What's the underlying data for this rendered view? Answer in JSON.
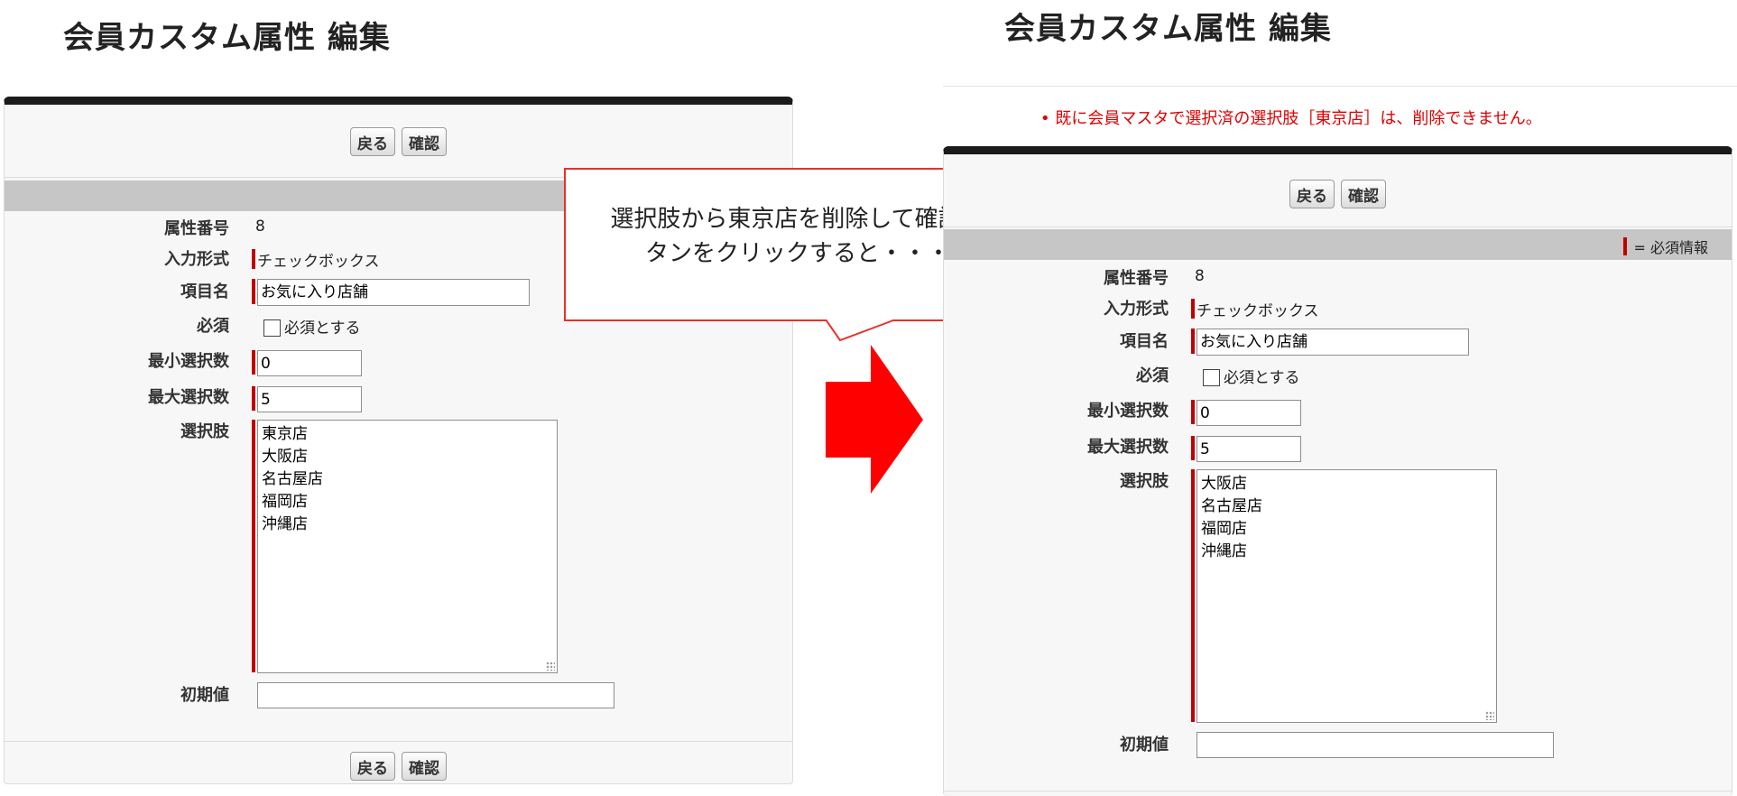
{
  "left": {
    "title": "会員カスタム属性 編集",
    "back_label": "戻る",
    "confirm_label": "確認",
    "fields": {
      "attr_no_label": "属性番号",
      "attr_no_value": "8",
      "input_type_label": "入力形式",
      "input_type_value": "チェックボックス",
      "item_name_label": "項目名",
      "item_name_value": "お気に入り店舗",
      "required_label": "必須",
      "required_checkbox_label": "必須とする",
      "min_label": "最小選択数",
      "min_value": "0",
      "max_label": "最大選択数",
      "max_value": "5",
      "choices_label": "選択肢",
      "choices": [
        "東京店",
        "大阪店",
        "名古屋店",
        "福岡店",
        "沖縄店"
      ],
      "initial_label": "初期値",
      "initial_value": ""
    }
  },
  "callout": {
    "line1": "選択肢から東京店を削除して確認ボ",
    "line2": "タンをクリックすると・・・"
  },
  "right": {
    "title": "会員カスタム属性 編集",
    "error_message": "既に会員マスタで選択済の選択肢［東京店］は、削除できません。",
    "back_label": "戻る",
    "confirm_label": "確認",
    "required_legend": "= 必須情報",
    "fields": {
      "attr_no_label": "属性番号",
      "attr_no_value": "8",
      "input_type_label": "入力形式",
      "input_type_value": "チェックボックス",
      "item_name_label": "項目名",
      "item_name_value": "お気に入り店舗",
      "required_label": "必須",
      "required_checkbox_label": "必須とする",
      "min_label": "最小選択数",
      "min_value": "0",
      "max_label": "最大選択数",
      "max_value": "5",
      "choices_label": "選択肢",
      "choices": [
        "大阪店",
        "名古屋店",
        "福岡店",
        "沖縄店"
      ],
      "initial_label": "初期値",
      "initial_value": ""
    }
  },
  "colors": {
    "required_bar": "#c00000",
    "error_text": "#e00000",
    "arrow": "#ff0000",
    "callout_border": "#e8312a"
  }
}
